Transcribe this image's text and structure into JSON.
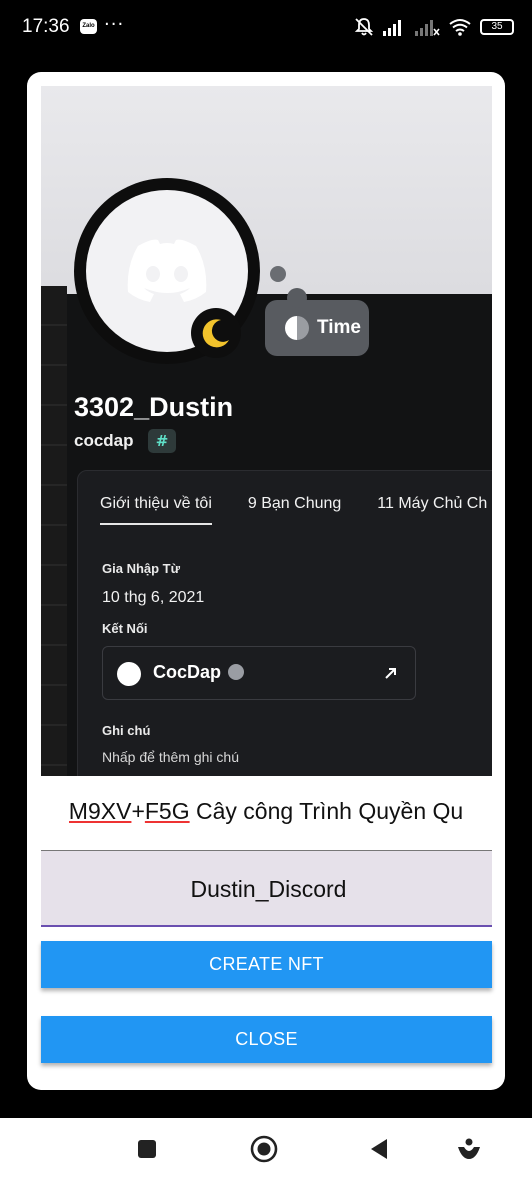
{
  "status_bar": {
    "time": "17:36",
    "zalo_label": "Zalo",
    "more": "···",
    "battery": "35",
    "icons": [
      "bell-off-icon",
      "signal-icon",
      "signal-x-icon",
      "wifi-icon",
      "battery-icon"
    ]
  },
  "photo": {
    "time_label": "Time",
    "username": "3302_Dustin",
    "tag": "cocdap",
    "tag_badge": "#",
    "tabs": [
      "Giới thiệu về tôi",
      "9 Bạn Chung",
      "11 Máy Chủ Ch"
    ],
    "joined_label": "Gia Nhập Từ",
    "joined_value": "10 thg 6, 2021",
    "connections_label": "Kết Nối",
    "connection_name": "CocDap",
    "note_label": "Ghi chú",
    "note_placeholder": "Nhấp để thêm ghi chú"
  },
  "address": {
    "code_part1": "M9XV",
    "plus": "+",
    "code_part2": "F5G",
    "rest": " Cây công Trình Quyền Qu"
  },
  "name_field": {
    "value": "Dustin_Discord"
  },
  "buttons": {
    "create": "CREATE NFT",
    "close": "CLOSE"
  },
  "nav": {
    "icons": [
      "recents-square-icon",
      "home-circle-icon",
      "back-triangle-icon",
      "assistant-icon"
    ]
  },
  "colors": {
    "accent": "#2196f3",
    "field_bg": "#e6e1ea",
    "field_underline": "#6a4fb0"
  }
}
